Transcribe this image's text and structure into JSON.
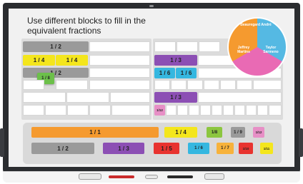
{
  "lesson": {
    "title": "Use different blocks to fill in the equivalent fractions"
  },
  "top_left_rows": {
    "row1": [
      "1 / 2"
    ],
    "row2": [
      "1 / 4",
      "1 / 4"
    ],
    "row3_partial": "1 / 2",
    "dragging": "1 / 8"
  },
  "middle_rows": {
    "row1": [
      "1 / 3"
    ],
    "row2": [
      "1 / 6",
      "1 / 6"
    ],
    "row3": [
      "1 / 3"
    ],
    "row4": [
      "1/12"
    ]
  },
  "pie_names": [
    "Beauregard André",
    "Jeffrey Martins",
    "Taylor Sarmeno"
  ],
  "palette_row1": [
    "1 / 1",
    "1 / 4",
    "1/8",
    "1 / 9",
    "1/12"
  ],
  "palette_row2": [
    "1 / 2",
    "1 / 3",
    "1 / 5",
    "1 / 6",
    "1 / 7",
    "1/10",
    "1/11"
  ],
  "colors": {
    "gray": "#9a9a9a",
    "yellow": "#f4e61c",
    "green": "#6cc04a",
    "purple": "#8c4fb4",
    "cyan": "#35b7e0",
    "pink": "#e78fc6",
    "orange": "#f59a2f",
    "red": "#e8332f",
    "light_orange": "#f7b23b",
    "light_green": "#8cc63f"
  }
}
